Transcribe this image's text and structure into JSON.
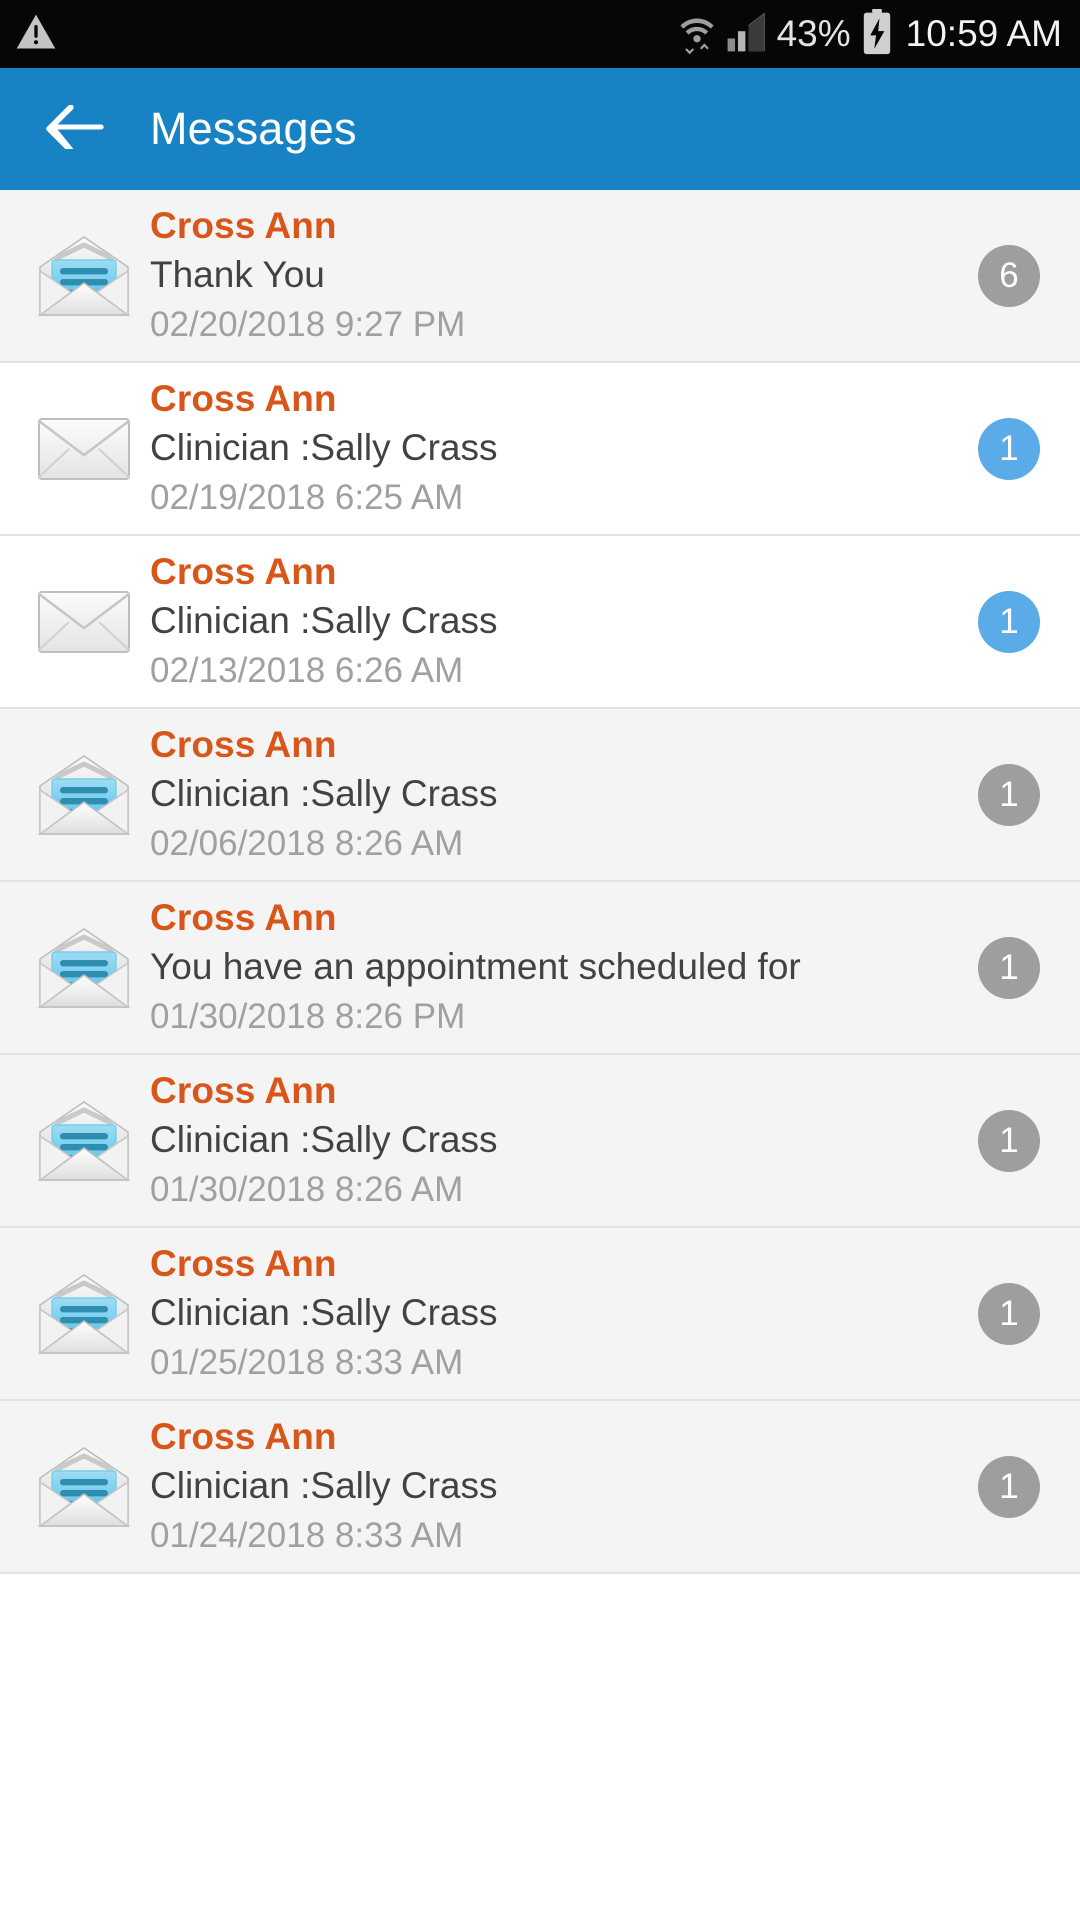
{
  "statusbar": {
    "warning_icon": "warning-triangle-icon",
    "wifi_icon": "wifi-transfer-icon",
    "signal_icon": "cellular-signal-icon",
    "battery_percent": "43%",
    "battery_icon": "battery-charging-icon",
    "clock": "10:59 AM"
  },
  "header": {
    "back_icon": "arrow-left-icon",
    "title": "Messages",
    "background_color": "#1783c4"
  },
  "colors": {
    "accent_blue": "#1783c4",
    "sender_orange": "#d9561b",
    "badge_gray": "#9e9e9e",
    "badge_blue": "#5babe8",
    "row_alt_bg": "#f4f4f4",
    "row_plain_bg": "#ffffff"
  },
  "messages": [
    {
      "sender": "Cross Ann",
      "subject": "Thank You",
      "timestamp": "02/20/2018  9:27 PM",
      "count": "6",
      "badge_style": "gray",
      "row_style": "alt",
      "icon": "envelope-open-icon"
    },
    {
      "sender": "Cross Ann",
      "subject": "Clinician  :Sally Crass",
      "timestamp": "02/19/2018  6:25 AM",
      "count": "1",
      "badge_style": "blue",
      "row_style": "plain",
      "icon": "envelope-closed-icon"
    },
    {
      "sender": "Cross Ann",
      "subject": "Clinician  :Sally Crass",
      "timestamp": "02/13/2018  6:26 AM",
      "count": "1",
      "badge_style": "blue",
      "row_style": "plain",
      "icon": "envelope-closed-icon"
    },
    {
      "sender": "Cross Ann",
      "subject": "Clinician  :Sally Crass",
      "timestamp": "02/06/2018  8:26 AM",
      "count": "1",
      "badge_style": "gray",
      "row_style": "alt",
      "icon": "envelope-open-icon"
    },
    {
      "sender": "Cross Ann",
      "subject": "You have an appointment scheduled for",
      "timestamp": "01/30/2018  8:26 PM",
      "count": "1",
      "badge_style": "gray",
      "row_style": "alt",
      "icon": "envelope-open-icon"
    },
    {
      "sender": "Cross Ann",
      "subject": "Clinician  :Sally Crass",
      "timestamp": "01/30/2018  8:26 AM",
      "count": "1",
      "badge_style": "gray",
      "row_style": "alt",
      "icon": "envelope-open-icon"
    },
    {
      "sender": "Cross Ann",
      "subject": "Clinician  :Sally Crass",
      "timestamp": "01/25/2018  8:33 AM",
      "count": "1",
      "badge_style": "gray",
      "row_style": "alt",
      "icon": "envelope-open-icon"
    },
    {
      "sender": "Cross Ann",
      "subject": "Clinician  :Sally Crass",
      "timestamp": "01/24/2018  8:33 AM",
      "count": "1",
      "badge_style": "gray",
      "row_style": "alt",
      "icon": "envelope-open-icon"
    }
  ]
}
